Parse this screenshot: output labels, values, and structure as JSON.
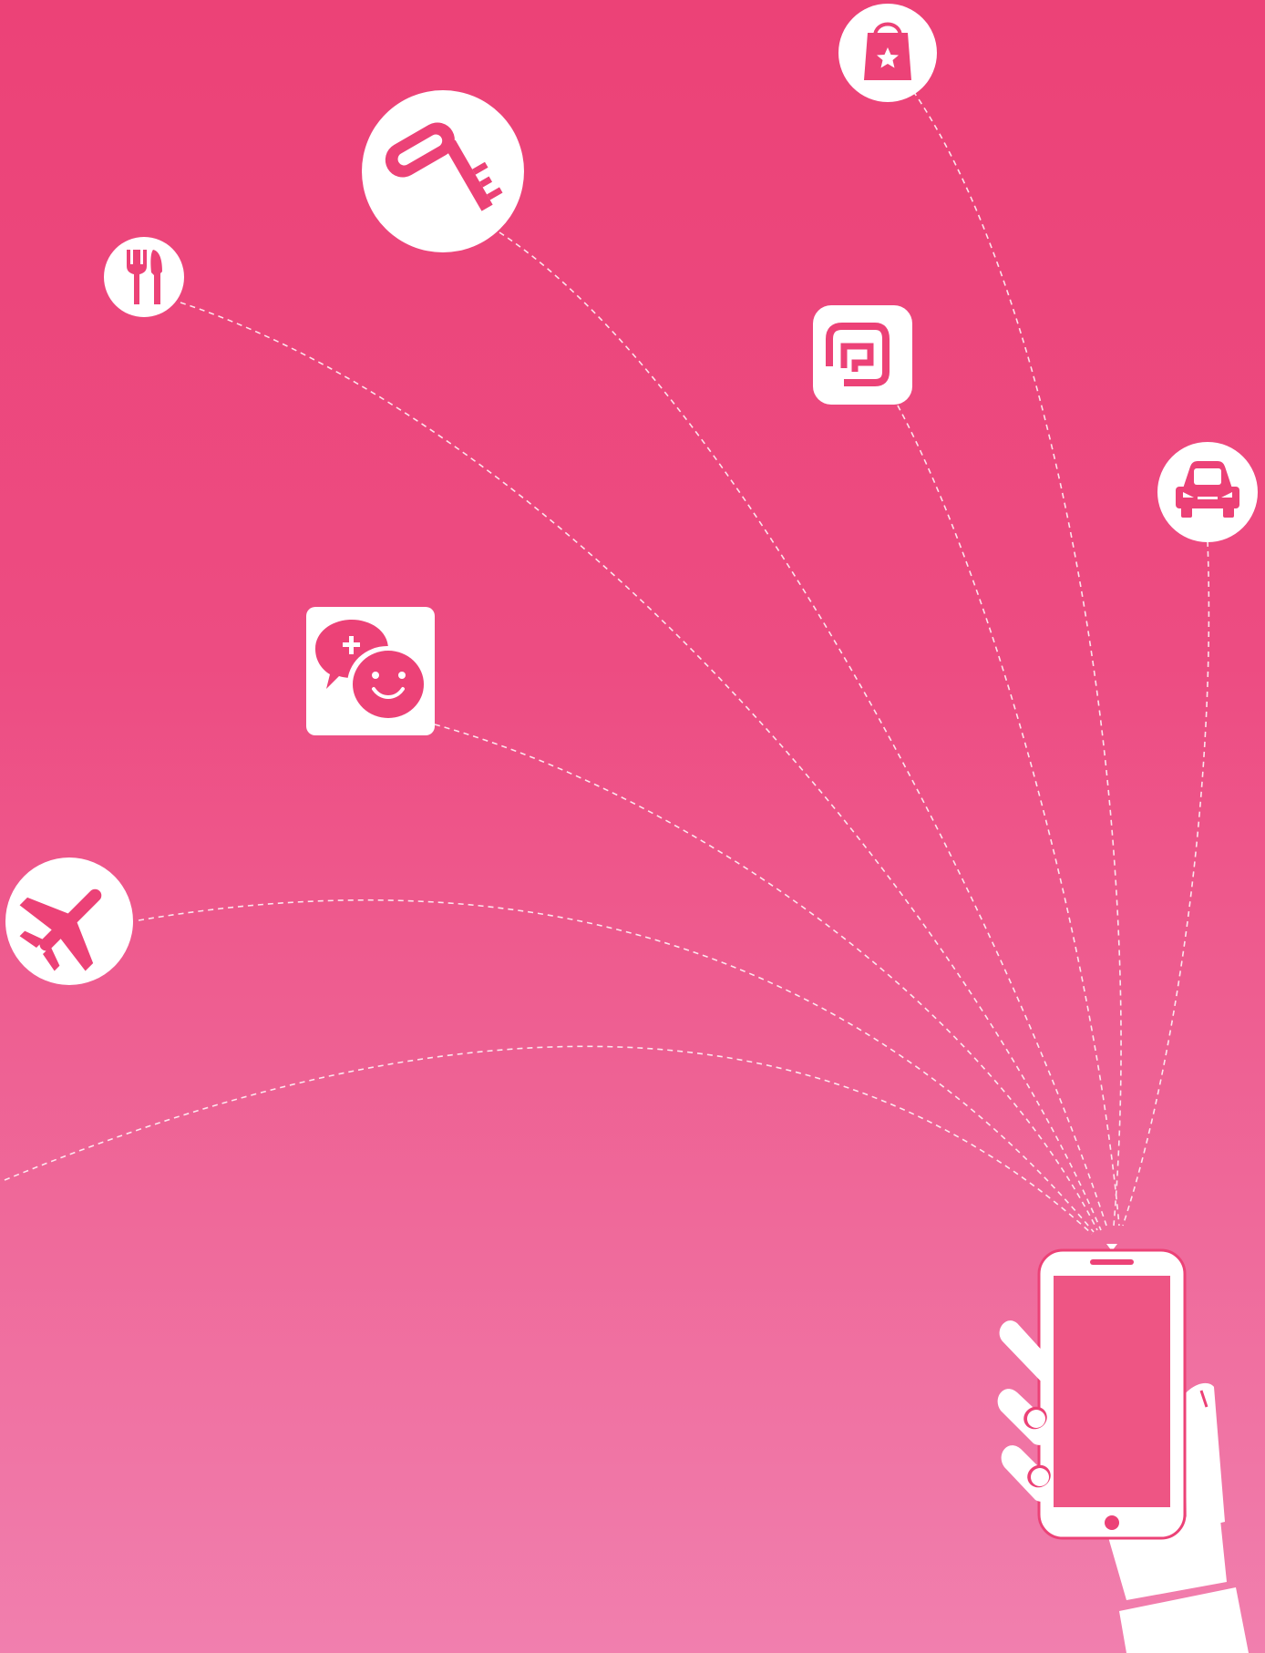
{
  "colors": {
    "background_top": "#EC4277",
    "background_bottom": "#F17FAE",
    "icon_fill": "#FFFFFF",
    "icon_glyph": "#EC4277"
  },
  "icons": [
    {
      "name": "shopping-bag-icon",
      "shape": "circle"
    },
    {
      "name": "key-icon",
      "shape": "circle"
    },
    {
      "name": "restaurant-fork-knife-icon",
      "shape": "circle"
    },
    {
      "name": "app-logo-icon",
      "shape": "rounded-square"
    },
    {
      "name": "taxi-car-icon",
      "shape": "circle"
    },
    {
      "name": "chat-smile-icon",
      "shape": "rounded-square"
    },
    {
      "name": "airplane-icon",
      "shape": "circle"
    },
    {
      "name": "hand-holding-phone-icon",
      "shape": "illustration"
    }
  ]
}
